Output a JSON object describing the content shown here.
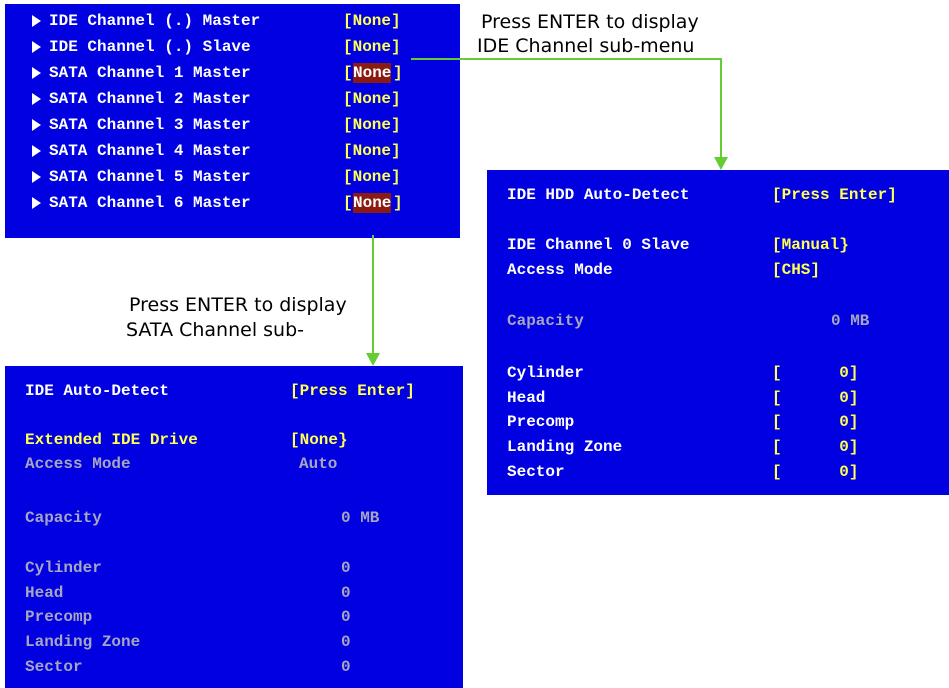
{
  "main_menu": {
    "rows": [
      {
        "label": "IDE Channel (.) Master",
        "value": "[None]",
        "highlighted": false
      },
      {
        "label": "IDE Channel (.) Slave",
        "value": "[None]",
        "highlighted": false
      },
      {
        "label": "SATA Channel 1 Master",
        "value": "None",
        "highlighted": true
      },
      {
        "label": "SATA Channel 2 Master",
        "value": "[None]",
        "highlighted": false
      },
      {
        "label": "SATA Channel 3 Master",
        "value": "[None]",
        "highlighted": false
      },
      {
        "label": "SATA Channel 4 Master",
        "value": "[None]",
        "highlighted": false
      },
      {
        "label": "SATA Channel 5 Master",
        "value": "[None]",
        "highlighted": false
      },
      {
        "label": "SATA Channel 6 Master",
        "value": "None",
        "highlighted": true
      }
    ]
  },
  "annotations": {
    "ide_note_line1": "Press ENTER to display",
    "ide_note_line2": "IDE Channel sub-menu",
    "sata_note_line1": "Press ENTER to display",
    "sata_note_line2": "SATA Channel sub-"
  },
  "ide_submenu": {
    "autodetect_label": "IDE HDD Auto-Detect",
    "autodetect_value": "[Press Enter]",
    "channel_label": "IDE Channel 0 Slave",
    "channel_value": "[Manual}",
    "access_label": "Access Mode",
    "access_value": "[CHS]",
    "capacity_label": "Capacity",
    "capacity_value": "0 MB",
    "params": [
      {
        "label": "Cylinder",
        "value": "[      0]"
      },
      {
        "label": "Head",
        "value": "[      0]"
      },
      {
        "label": "Precomp",
        "value": "[      0]"
      },
      {
        "label": "Landing Zone",
        "value": "[      0]"
      },
      {
        "label": "Sector",
        "value": "[      0]"
      }
    ]
  },
  "sata_submenu": {
    "autodetect_label": "IDE Auto-Detect",
    "autodetect_value": "[Press Enter]",
    "drive_label": "Extended IDE Drive",
    "drive_value": "[None}",
    "access_label": "Access Mode",
    "access_value": "Auto",
    "capacity_label": "Capacity",
    "capacity_value": "0 MB",
    "params": [
      {
        "label": "Cylinder",
        "value": "0"
      },
      {
        "label": "Head",
        "value": "0"
      },
      {
        "label": "Precomp",
        "value": "0"
      },
      {
        "label": "Landing Zone",
        "value": "0"
      },
      {
        "label": "Sector",
        "value": "0"
      }
    ]
  },
  "colors": {
    "panel": "#0000e0",
    "label": "#ffffff",
    "value": "#ffff55",
    "disabled": "#a6a6c2",
    "highlight": "#8b1a10",
    "connector": "#66cc33"
  }
}
